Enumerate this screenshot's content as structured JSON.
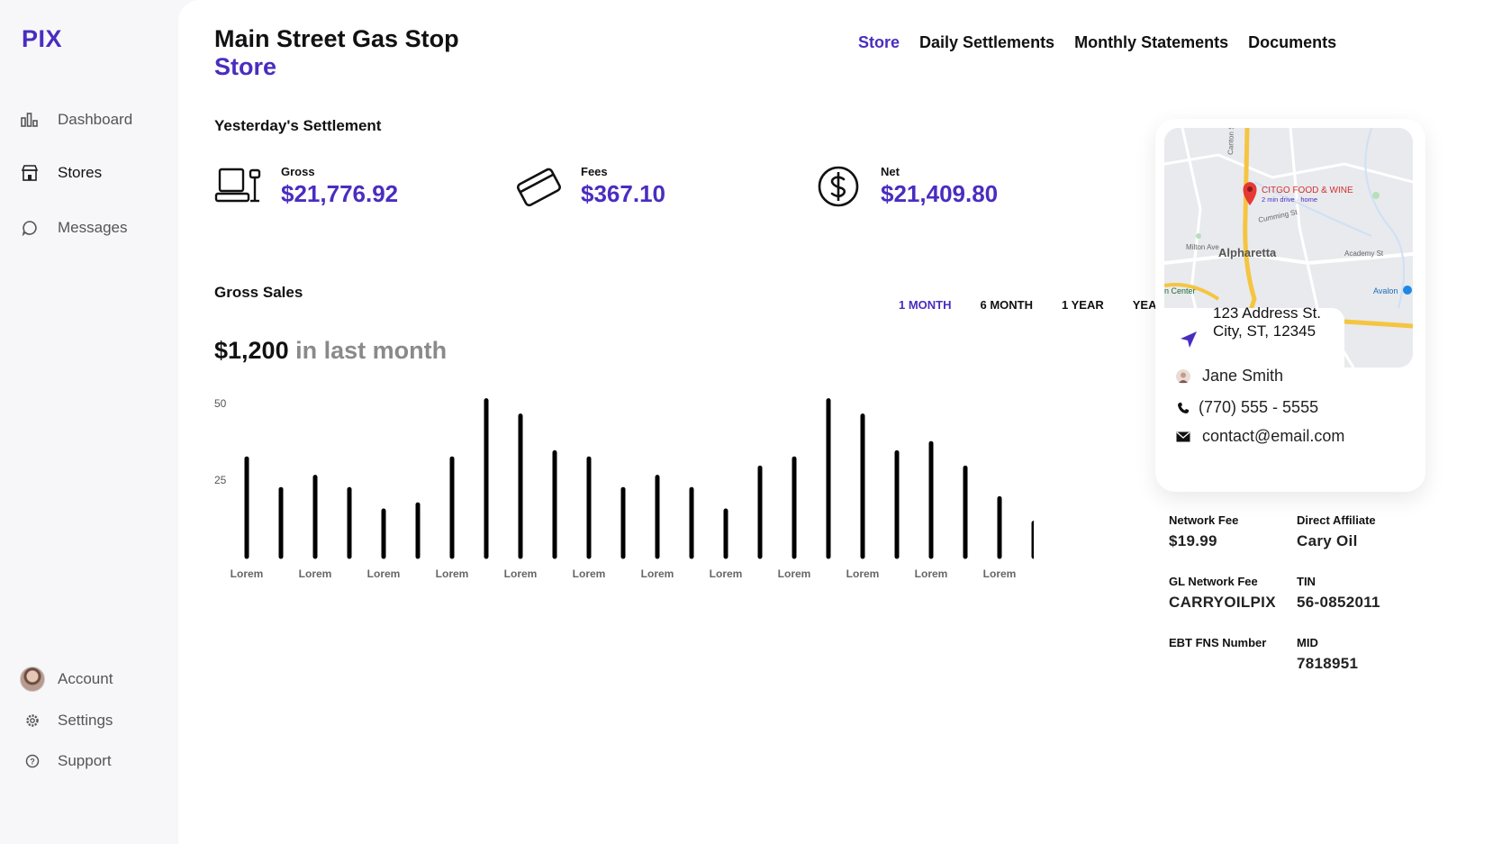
{
  "app": {
    "logo": "PIX"
  },
  "sidebar": {
    "items": [
      {
        "label": "Dashboard",
        "icon": "bar-chart-icon"
      },
      {
        "label": "Stores",
        "icon": "store-icon"
      },
      {
        "label": "Messages",
        "icon": "chat-icon"
      }
    ],
    "bottom": [
      {
        "label": "Account",
        "icon": "avatar"
      },
      {
        "label": "Settings",
        "icon": "gear-icon"
      },
      {
        "label": "Support",
        "icon": "help-icon"
      }
    ]
  },
  "header": {
    "title": "Main Street Gas Stop",
    "subtitle": "Store",
    "tabs": [
      "Store",
      "Daily Settlements",
      "Monthly Statements",
      "Documents"
    ],
    "active_tab": "Store"
  },
  "settlement": {
    "title": "Yesterday's Settlement",
    "gross": {
      "label": "Gross",
      "value": "$21,776.92"
    },
    "fees": {
      "label": "Fees",
      "value": "$367.10"
    },
    "net": {
      "label": "Net",
      "value": "$21,409.80"
    }
  },
  "gross_sales": {
    "title": "Gross Sales",
    "ranges": [
      "1 MONTH",
      "6 MONTH",
      "1 YEAR",
      "YEAR OVER YEAR"
    ],
    "active_range": "1 MONTH",
    "amount": "$1,200",
    "amount_suffix": "in last month"
  },
  "chart_data": {
    "type": "bar",
    "y_ticks": [
      "50",
      "25"
    ],
    "ylim": [
      0,
      50
    ],
    "x_tick_labels": [
      "Lorem",
      "Lorem",
      "Lorem",
      "Lorem",
      "Lorem",
      "Lorem",
      "Lorem",
      "Lorem",
      "Lorem",
      "Lorem",
      "Lorem",
      "Lorem"
    ],
    "values": [
      32,
      22,
      26,
      22,
      15,
      17,
      32,
      51,
      46,
      34,
      32,
      22,
      26,
      22,
      15,
      29,
      32,
      51,
      46,
      34,
      37,
      29,
      19,
      11
    ]
  },
  "store_card": {
    "map": {
      "place_name": "CITGO FOOD & WINE",
      "place_note": "2 min drive · home",
      "city": "Alpharetta",
      "streets": [
        "Canton St",
        "Cumming St",
        "Milton Ave",
        "Academy St"
      ],
      "left_label": "n Center",
      "right_label": "Avalon"
    },
    "address_line1": "123 Address St.",
    "address_line2": "City, ST, 12345",
    "contact_name": "Jane Smith",
    "phone": "(770) 555 - 5555",
    "email": "contact@email.com"
  },
  "details": [
    {
      "label": "Network Fee",
      "value": "$19.99"
    },
    {
      "label": "Direct Affiliate",
      "value": "Cary Oil"
    },
    {
      "label": "GL Network Fee",
      "value": "CARRYOILPIX"
    },
    {
      "label": "TIN",
      "value": "56-0852011"
    },
    {
      "label": "EBT FNS Number",
      "value": ""
    },
    {
      "label": "MID",
      "value": "7818951"
    }
  ],
  "colors": {
    "accent": "#4a2dbf",
    "map_pin": "#e53935",
    "road": "#f5c542"
  }
}
